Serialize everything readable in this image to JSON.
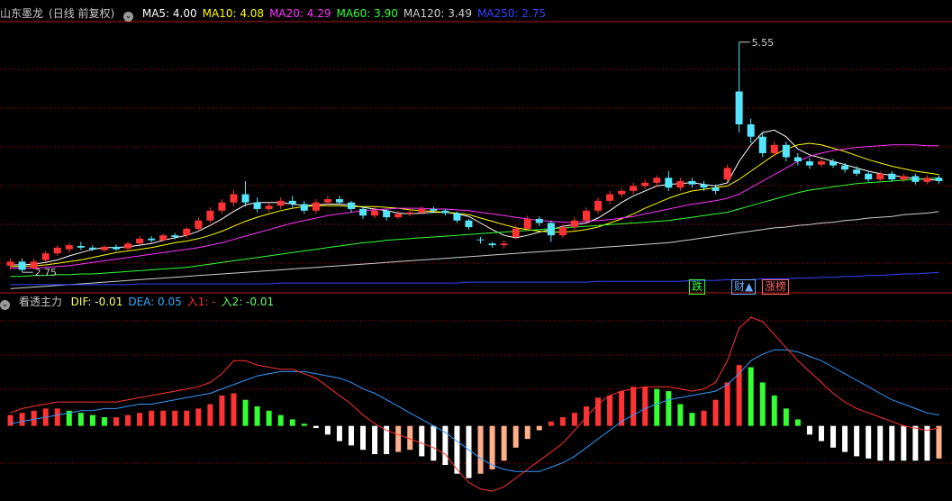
{
  "header_main": {
    "stock": "山东墨龙",
    "mode": "(日线 前复权)",
    "ma_items": [
      {
        "label": "MA5: 4.00",
        "color": "#ffffff"
      },
      {
        "label": "MA10: 4.08",
        "color": "#ffff00"
      },
      {
        "label": "MA20: 4.29",
        "color": "#ff33ff"
      },
      {
        "label": "MA60: 3.90",
        "color": "#33ff33"
      },
      {
        "label": "MA120: 3.49",
        "color": "#cfcfcf"
      },
      {
        "label": "MA250: 2.75",
        "color": "#3344ff"
      }
    ]
  },
  "header_sub": {
    "indicator": "看透主力",
    "items": [
      {
        "label": "DIF: -0.01",
        "color": "#ffff66"
      },
      {
        "label": "DEA: 0.05",
        "color": "#33aaff"
      },
      {
        "label": "入1: -",
        "color": "#ff3333"
      },
      {
        "label": "入2: -0.01",
        "color": "#66ff66"
      }
    ]
  },
  "badges": [
    {
      "text": "跌",
      "color": "#33ff33"
    },
    {
      "text": "财▲",
      "color": "#66aaff"
    },
    {
      "text": "涨榜",
      "color": "#ff6666"
    }
  ],
  "colors": {
    "up": "#ff3333",
    "down": "#55e6ff",
    "grid": "#8b0000",
    "dif": "#ff3333",
    "dea": "#3399ff"
  },
  "chart_data": [
    {
      "type": "candlestick",
      "title": "山东墨龙 (日线 前复权)",
      "ylim": [
        2.5,
        5.8
      ],
      "annotations": [
        {
          "label": "5.55",
          "x": 62,
          "y": 5.55
        },
        {
          "label": "2.75",
          "x": 1,
          "y": 2.75
        }
      ],
      "candles": [
        [
          2.83,
          2.88,
          2.78,
          2.92
        ],
        [
          2.88,
          2.78,
          2.75,
          2.92
        ],
        [
          2.8,
          2.88,
          2.78,
          2.92
        ],
        [
          2.9,
          2.98,
          2.88,
          3.01
        ],
        [
          2.98,
          3.05,
          2.95,
          3.08
        ],
        [
          3.03,
          3.08,
          2.99,
          3.11
        ],
        [
          3.07,
          3.05,
          3.02,
          3.12
        ],
        [
          3.05,
          3.03,
          3.01,
          3.08
        ],
        [
          3.02,
          3.06,
          3.0,
          3.08
        ],
        [
          3.06,
          3.03,
          3.01,
          3.09
        ],
        [
          3.04,
          3.1,
          3.02,
          3.12
        ],
        [
          3.1,
          3.16,
          3.08,
          3.19
        ],
        [
          3.16,
          3.14,
          3.11,
          3.19
        ],
        [
          3.14,
          3.2,
          3.12,
          3.22
        ],
        [
          3.2,
          3.18,
          3.15,
          3.23
        ],
        [
          3.2,
          3.28,
          3.17,
          3.3
        ],
        [
          3.28,
          3.38,
          3.25,
          3.42
        ],
        [
          3.38,
          3.5,
          3.35,
          3.54
        ],
        [
          3.5,
          3.6,
          3.46,
          3.64
        ],
        [
          3.6,
          3.7,
          3.55,
          3.75
        ],
        [
          3.7,
          3.6,
          3.55,
          3.86
        ],
        [
          3.6,
          3.52,
          3.48,
          3.66
        ],
        [
          3.52,
          3.56,
          3.48,
          3.6
        ],
        [
          3.56,
          3.62,
          3.52,
          3.66
        ],
        [
          3.62,
          3.58,
          3.54,
          3.68
        ],
        [
          3.58,
          3.5,
          3.46,
          3.62
        ],
        [
          3.5,
          3.6,
          3.46,
          3.64
        ],
        [
          3.6,
          3.64,
          3.56,
          3.68
        ],
        [
          3.64,
          3.6,
          3.58,
          3.68
        ],
        [
          3.6,
          3.52,
          3.48,
          3.62
        ],
        [
          3.52,
          3.44,
          3.4,
          3.55
        ],
        [
          3.44,
          3.5,
          3.41,
          3.54
        ],
        [
          3.5,
          3.42,
          3.38,
          3.52
        ],
        [
          3.42,
          3.46,
          3.4,
          3.5
        ],
        [
          3.46,
          3.48,
          3.43,
          3.52
        ],
        [
          3.48,
          3.52,
          3.45,
          3.55
        ],
        [
          3.52,
          3.5,
          3.47,
          3.55
        ],
        [
          3.5,
          3.47,
          3.44,
          3.52
        ],
        [
          3.47,
          3.38,
          3.35,
          3.49
        ],
        [
          3.38,
          3.3,
          3.27,
          3.4
        ],
        [
          3.15,
          3.14,
          3.1,
          3.18
        ],
        [
          3.1,
          3.08,
          3.05,
          3.12
        ],
        [
          3.08,
          3.1,
          3.04,
          3.14
        ],
        [
          3.18,
          3.28,
          3.15,
          3.32
        ],
        [
          3.28,
          3.4,
          3.25,
          3.44
        ],
        [
          3.4,
          3.35,
          3.31,
          3.43
        ],
        [
          3.35,
          3.2,
          3.12,
          3.38
        ],
        [
          3.2,
          3.3,
          3.17,
          3.33
        ],
        [
          3.3,
          3.38,
          3.26,
          3.42
        ],
        [
          3.38,
          3.5,
          3.35,
          3.54
        ],
        [
          3.5,
          3.62,
          3.46,
          3.66
        ],
        [
          3.62,
          3.7,
          3.58,
          3.74
        ],
        [
          3.7,
          3.74,
          3.66,
          3.78
        ],
        [
          3.74,
          3.8,
          3.7,
          3.84
        ],
        [
          3.8,
          3.84,
          3.76,
          3.88
        ],
        [
          3.84,
          3.9,
          3.79,
          3.93
        ],
        [
          3.9,
          3.78,
          3.74,
          3.98
        ],
        [
          3.78,
          3.86,
          3.74,
          3.9
        ],
        [
          3.86,
          3.82,
          3.78,
          3.9
        ],
        [
          3.82,
          3.78,
          3.74,
          3.86
        ],
        [
          3.78,
          3.74,
          3.7,
          3.82
        ],
        [
          3.88,
          4.02,
          3.85,
          4.06
        ],
        [
          4.95,
          4.55,
          4.45,
          5.55
        ],
        [
          4.55,
          4.4,
          4.32,
          4.62
        ],
        [
          4.4,
          4.2,
          4.15,
          4.46
        ],
        [
          4.2,
          4.3,
          4.16,
          4.34
        ],
        [
          4.3,
          4.15,
          4.1,
          4.34
        ],
        [
          4.15,
          4.1,
          4.05,
          4.2
        ],
        [
          4.1,
          4.05,
          4.01,
          4.14
        ],
        [
          4.06,
          4.1,
          4.03,
          4.13
        ],
        [
          4.1,
          4.05,
          4.02,
          4.13
        ],
        [
          4.05,
          4.0,
          3.96,
          4.08
        ],
        [
          4.0,
          3.95,
          3.92,
          4.04
        ],
        [
          3.95,
          3.88,
          3.85,
          3.98
        ],
        [
          3.88,
          3.95,
          3.85,
          3.98
        ],
        [
          3.95,
          3.88,
          3.85,
          3.98
        ],
        [
          3.88,
          3.92,
          3.85,
          3.95
        ],
        [
          3.92,
          3.85,
          3.82,
          3.95
        ],
        [
          3.85,
          3.9,
          3.82,
          3.93
        ],
        [
          3.9,
          3.86,
          3.83,
          3.93
        ]
      ],
      "ma": {
        "MA5": [
          2.84,
          2.84,
          2.85,
          2.87,
          2.9,
          2.95,
          2.99,
          3.03,
          3.05,
          3.05,
          3.06,
          3.08,
          3.1,
          3.14,
          3.17,
          3.2,
          3.25,
          3.32,
          3.4,
          3.49,
          3.57,
          3.6,
          3.6,
          3.6,
          3.58,
          3.56,
          3.57,
          3.58,
          3.58,
          3.57,
          3.54,
          3.52,
          3.5,
          3.47,
          3.46,
          3.47,
          3.48,
          3.48,
          3.46,
          3.43,
          3.35,
          3.27,
          3.2,
          3.17,
          3.2,
          3.24,
          3.27,
          3.31,
          3.33,
          3.35,
          3.41,
          3.5,
          3.6,
          3.68,
          3.74,
          3.8,
          3.82,
          3.83,
          3.84,
          3.82,
          3.8,
          3.84,
          4.1,
          4.3,
          4.45,
          4.48,
          4.4,
          4.25,
          4.18,
          4.14,
          4.1,
          4.06,
          4.02,
          3.98,
          3.95,
          3.93,
          3.91,
          3.89,
          3.88,
          3.87
        ],
        "MA10": [
          2.82,
          2.82,
          2.83,
          2.84,
          2.86,
          2.88,
          2.9,
          2.93,
          2.96,
          2.99,
          3.01,
          3.03,
          3.05,
          3.08,
          3.11,
          3.13,
          3.16,
          3.2,
          3.25,
          3.31,
          3.37,
          3.42,
          3.46,
          3.5,
          3.53,
          3.55,
          3.56,
          3.56,
          3.56,
          3.55,
          3.55,
          3.55,
          3.54,
          3.53,
          3.51,
          3.5,
          3.49,
          3.48,
          3.47,
          3.45,
          3.41,
          3.37,
          3.33,
          3.29,
          3.27,
          3.25,
          3.24,
          3.24,
          3.25,
          3.27,
          3.3,
          3.35,
          3.4,
          3.46,
          3.53,
          3.59,
          3.65,
          3.7,
          3.74,
          3.76,
          3.78,
          3.8,
          3.88,
          3.98,
          4.08,
          4.18,
          4.25,
          4.3,
          4.32,
          4.3,
          4.26,
          4.22,
          4.17,
          4.12,
          4.08,
          4.04,
          4.01,
          3.98,
          3.96,
          3.94
        ],
        "MA20": [
          2.8,
          2.8,
          2.8,
          2.81,
          2.82,
          2.83,
          2.85,
          2.87,
          2.89,
          2.91,
          2.93,
          2.95,
          2.97,
          2.99,
          3.01,
          3.03,
          3.05,
          3.08,
          3.11,
          3.15,
          3.19,
          3.23,
          3.27,
          3.31,
          3.35,
          3.38,
          3.41,
          3.44,
          3.46,
          3.48,
          3.5,
          3.51,
          3.52,
          3.53,
          3.53,
          3.53,
          3.52,
          3.52,
          3.51,
          3.5,
          3.48,
          3.46,
          3.44,
          3.42,
          3.4,
          3.38,
          3.37,
          3.36,
          3.36,
          3.37,
          3.38,
          3.39,
          3.41,
          3.43,
          3.46,
          3.49,
          3.52,
          3.55,
          3.58,
          3.6,
          3.62,
          3.65,
          3.7,
          3.78,
          3.86,
          3.94,
          4.02,
          4.1,
          4.16,
          4.2,
          4.23,
          4.25,
          4.27,
          4.28,
          4.29,
          4.3,
          4.3,
          4.3,
          4.29,
          4.29
        ],
        "MA60": [
          2.7,
          2.7,
          2.71,
          2.71,
          2.72,
          2.72,
          2.73,
          2.73,
          2.74,
          2.75,
          2.76,
          2.77,
          2.78,
          2.79,
          2.8,
          2.81,
          2.83,
          2.85,
          2.87,
          2.89,
          2.91,
          2.93,
          2.95,
          2.97,
          2.99,
          3.01,
          3.03,
          3.05,
          3.07,
          3.09,
          3.11,
          3.12,
          3.14,
          3.15,
          3.16,
          3.17,
          3.18,
          3.19,
          3.2,
          3.21,
          3.22,
          3.23,
          3.24,
          3.25,
          3.26,
          3.27,
          3.28,
          3.29,
          3.3,
          3.31,
          3.32,
          3.33,
          3.34,
          3.35,
          3.36,
          3.37,
          3.38,
          3.4,
          3.42,
          3.44,
          3.46,
          3.48,
          3.52,
          3.56,
          3.6,
          3.64,
          3.68,
          3.72,
          3.75,
          3.77,
          3.79,
          3.81,
          3.83,
          3.84,
          3.85,
          3.86,
          3.87,
          3.88,
          3.89,
          3.9
        ],
        "MA120": [
          2.55,
          2.56,
          2.57,
          2.58,
          2.59,
          2.6,
          2.61,
          2.62,
          2.63,
          2.64,
          2.65,
          2.66,
          2.67,
          2.68,
          2.69,
          2.7,
          2.71,
          2.72,
          2.73,
          2.74,
          2.75,
          2.76,
          2.77,
          2.78,
          2.79,
          2.8,
          2.81,
          2.82,
          2.83,
          2.84,
          2.85,
          2.86,
          2.87,
          2.88,
          2.89,
          2.9,
          2.91,
          2.92,
          2.93,
          2.94,
          2.95,
          2.96,
          2.97,
          2.98,
          2.99,
          3.0,
          3.01,
          3.02,
          3.03,
          3.04,
          3.05,
          3.06,
          3.07,
          3.08,
          3.09,
          3.1,
          3.11,
          3.13,
          3.15,
          3.17,
          3.19,
          3.21,
          3.23,
          3.25,
          3.27,
          3.29,
          3.3,
          3.32,
          3.33,
          3.35,
          3.36,
          3.38,
          3.39,
          3.41,
          3.42,
          3.43,
          3.45,
          3.46,
          3.47,
          3.49
        ],
        "MA250": [
          2.6,
          2.6,
          2.6,
          2.6,
          2.6,
          2.6,
          2.6,
          2.6,
          2.6,
          2.6,
          2.6,
          2.61,
          2.61,
          2.61,
          2.61,
          2.61,
          2.61,
          2.61,
          2.61,
          2.61,
          2.61,
          2.61,
          2.61,
          2.62,
          2.62,
          2.62,
          2.62,
          2.62,
          2.62,
          2.62,
          2.62,
          2.62,
          2.62,
          2.62,
          2.62,
          2.62,
          2.62,
          2.62,
          2.62,
          2.63,
          2.63,
          2.63,
          2.63,
          2.63,
          2.63,
          2.63,
          2.63,
          2.63,
          2.63,
          2.63,
          2.64,
          2.64,
          2.64,
          2.64,
          2.64,
          2.64,
          2.64,
          2.64,
          2.65,
          2.65,
          2.65,
          2.66,
          2.66,
          2.66,
          2.67,
          2.67,
          2.67,
          2.68,
          2.68,
          2.69,
          2.69,
          2.7,
          2.7,
          2.71,
          2.71,
          2.72,
          2.73,
          2.73,
          2.74,
          2.75
        ]
      }
    },
    {
      "type": "macd",
      "title": "看透主力",
      "ylim": [
        -0.3,
        0.55
      ],
      "dif": [
        0.06,
        0.08,
        0.09,
        0.1,
        0.11,
        0.11,
        0.11,
        0.11,
        0.11,
        0.11,
        0.12,
        0.13,
        0.14,
        0.15,
        0.16,
        0.17,
        0.18,
        0.2,
        0.24,
        0.3,
        0.3,
        0.28,
        0.27,
        0.26,
        0.26,
        0.24,
        0.22,
        0.18,
        0.14,
        0.1,
        0.05,
        0.01,
        -0.02,
        -0.04,
        -0.06,
        -0.08,
        -0.1,
        -0.13,
        -0.2,
        -0.26,
        -0.29,
        -0.3,
        -0.28,
        -0.24,
        -0.2,
        -0.16,
        -0.12,
        -0.08,
        -0.02,
        0.04,
        0.1,
        0.14,
        0.16,
        0.17,
        0.18,
        0.18,
        0.18,
        0.17,
        0.16,
        0.17,
        0.2,
        0.3,
        0.45,
        0.5,
        0.48,
        0.42,
        0.36,
        0.3,
        0.25,
        0.2,
        0.15,
        0.11,
        0.08,
        0.06,
        0.04,
        0.02,
        0.0,
        -0.01,
        -0.02,
        -0.01
      ],
      "dea": [
        0.01,
        0.02,
        0.03,
        0.04,
        0.05,
        0.06,
        0.07,
        0.07,
        0.08,
        0.08,
        0.09,
        0.1,
        0.1,
        0.11,
        0.12,
        0.13,
        0.14,
        0.15,
        0.17,
        0.19,
        0.21,
        0.23,
        0.24,
        0.25,
        0.25,
        0.25,
        0.24,
        0.23,
        0.22,
        0.2,
        0.17,
        0.15,
        0.12,
        0.09,
        0.06,
        0.03,
        0.0,
        -0.03,
        -0.07,
        -0.11,
        -0.15,
        -0.18,
        -0.2,
        -0.21,
        -0.21,
        -0.21,
        -0.19,
        -0.17,
        -0.14,
        -0.1,
        -0.06,
        -0.02,
        0.02,
        0.05,
        0.08,
        0.1,
        0.12,
        0.13,
        0.14,
        0.15,
        0.16,
        0.19,
        0.24,
        0.3,
        0.33,
        0.35,
        0.35,
        0.34,
        0.32,
        0.3,
        0.27,
        0.24,
        0.21,
        0.18,
        0.15,
        0.12,
        0.1,
        0.08,
        0.06,
        0.05
      ],
      "hist": [
        0.05,
        0.06,
        0.07,
        0.08,
        0.08,
        0.07,
        0.06,
        0.05,
        0.04,
        0.04,
        0.05,
        0.06,
        0.07,
        0.07,
        0.07,
        0.07,
        0.08,
        0.1,
        0.14,
        0.15,
        0.12,
        0.09,
        0.07,
        0.05,
        0.03,
        0.01,
        -0.01,
        -0.04,
        -0.07,
        -0.09,
        -0.11,
        -0.13,
        -0.13,
        -0.12,
        -0.11,
        -0.14,
        -0.16,
        -0.18,
        -0.22,
        -0.24,
        -0.22,
        -0.2,
        -0.16,
        -0.1,
        -0.06,
        -0.02,
        0.02,
        0.04,
        0.06,
        0.09,
        0.13,
        0.14,
        0.16,
        0.18,
        0.18,
        0.17,
        0.16,
        0.1,
        0.06,
        0.07,
        0.12,
        0.2,
        0.28,
        0.27,
        0.2,
        0.14,
        0.08,
        0.03,
        -0.04,
        -0.07,
        -0.1,
        -0.12,
        -0.14,
        -0.15,
        -0.16,
        -0.16,
        -0.16,
        -0.16,
        -0.16,
        -0.15
      ]
    }
  ]
}
